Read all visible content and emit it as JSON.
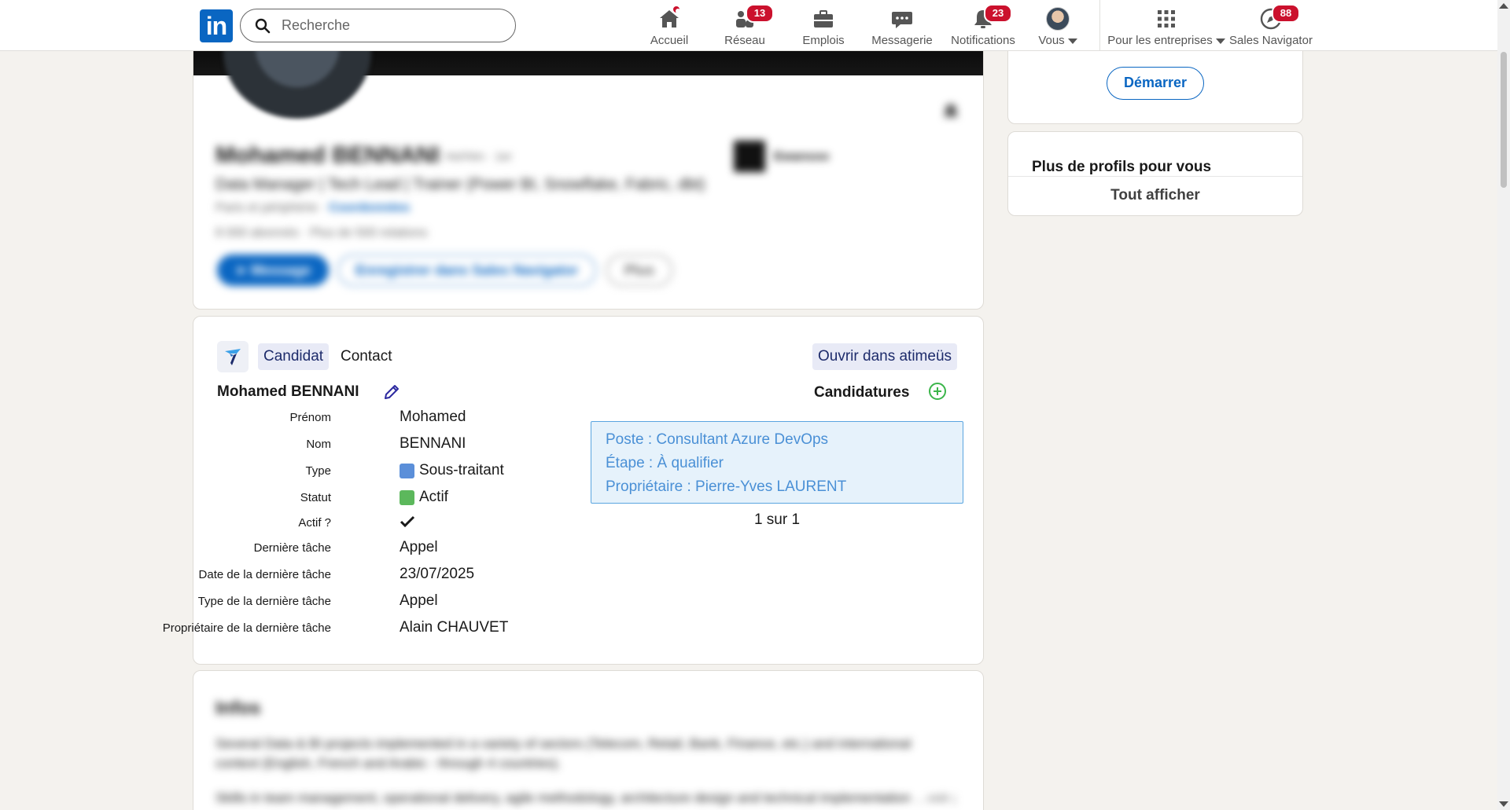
{
  "nav": {
    "search_placeholder": "Recherche",
    "items": [
      {
        "label": "Accueil",
        "badge": ""
      },
      {
        "label": "Réseau",
        "badge": "13"
      },
      {
        "label": "Emplois",
        "badge": ""
      },
      {
        "label": "Messagerie",
        "badge": ""
      },
      {
        "label": "Notifications",
        "badge": "23"
      },
      {
        "label": "Vous",
        "badge": ""
      },
      {
        "label": "Pour les entreprises",
        "badge": ""
      },
      {
        "label": "Sales Navigator",
        "badge": "88"
      }
    ]
  },
  "profile": {
    "name": "Mohamed BENNANI",
    "pronouns": "He/Him · 1er",
    "headline": "Data Manager | Tech Lead | Trainer (Power BI, Snowflake, Fabric, dbt)",
    "location": "Paris et périphérie",
    "contact_link": "Coordonnées",
    "relations": "8 000 abonnés · Plus de 500 relations",
    "message_button": "Message",
    "save_button": "Enregistrer dans Sales Navigator",
    "more_button": "Plus",
    "company": "Ewansoo"
  },
  "crm": {
    "tab_candidate": "Candidat",
    "tab_contact": "Contact",
    "open_button": "Ouvrir dans atimeüs",
    "full_name": "Mohamed BENNANI",
    "fields": [
      {
        "label": "Prénom",
        "value": "Mohamed"
      },
      {
        "label": "Nom",
        "value": "BENNANI"
      },
      {
        "label": "Type",
        "value": "Sous-traitant"
      },
      {
        "label": "Statut",
        "value": "Actif"
      },
      {
        "label": "Actif ?",
        "value": ""
      },
      {
        "label": "Dernière tâche",
        "value": "Appel"
      },
      {
        "label": "Date de la dernière tâche",
        "value": "23/07/2025"
      },
      {
        "label": "Type de la dernière tâche",
        "value": "Appel"
      },
      {
        "label": "Propriétaire de la dernière tâche",
        "value": "Alain CHAUVET"
      }
    ],
    "type_color": "#5b8fd9",
    "status_color": "#5cb85c",
    "applications_title": "Candidatures",
    "application": {
      "poste": "Poste : Consultant Azure DevOps",
      "etape": "Étape : À qualifier",
      "proprietaire": "Propriétaire : Pierre-Yves LAURENT"
    },
    "pager": "1 sur 1"
  },
  "infos": {
    "title": "Infos",
    "text": "Several Data & BI projects implemented in a variety of sectors (Telecom, Retail, Bank, Finance, etc.) and international context (English, French and Arabic - through 4 countries).",
    "text2": "Skills in team management, operational delivery, agile methodology, architecture design and technical implementation",
    "see_more": "…voir plus"
  },
  "sidebar": {
    "start_button": "Démarrer",
    "profiles_title": "Plus de profils pour vous",
    "show_all": "Tout afficher"
  },
  "colors": {
    "linkedin_blue": "#0a66c2",
    "badge_red": "#cb112d",
    "crm_accent": "#1d2b6b"
  }
}
